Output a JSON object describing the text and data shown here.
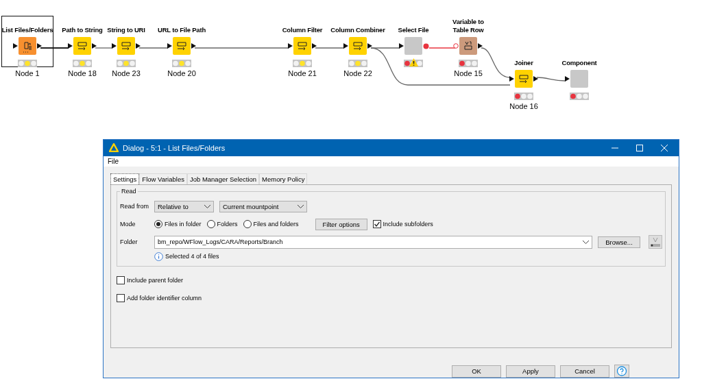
{
  "workflow": {
    "nodes": [
      {
        "label": "List Files/Folders",
        "name": "Node 1",
        "kind": "source",
        "configured": true,
        "selected": true
      },
      {
        "label": "Path to String",
        "name": "Node 18",
        "kind": "manipulator",
        "configured": true,
        "selected": false
      },
      {
        "label": "String to URI",
        "name": "Node 23",
        "kind": "manipulator",
        "configured": true,
        "selected": false
      },
      {
        "label": "URL to File Path",
        "name": "Node 20",
        "kind": "manipulator",
        "configured": true,
        "selected": false
      },
      {
        "label": "Column Filter",
        "name": "Node 21",
        "kind": "manipulator",
        "configured": true,
        "selected": false
      },
      {
        "label": "Column Combiner",
        "name": "Node 22",
        "kind": "manipulator",
        "configured": true,
        "selected": false
      },
      {
        "label": "Select File",
        "kind": "missing",
        "configured": false,
        "warning": true,
        "selected": false
      },
      {
        "label": "Variable to Table Row",
        "name": "Node 15",
        "kind": "variable",
        "configured": false,
        "selected": false
      },
      {
        "label": "Joiner",
        "name": "Node 16",
        "kind": "manipulator",
        "configured": false,
        "selected": false
      },
      {
        "label": "Component",
        "kind": "missing",
        "configured": false,
        "selected": false
      }
    ]
  },
  "dialog": {
    "title": "Dialog - 5:1 - List Files/Folders",
    "menu": [
      "File"
    ],
    "tabs": [
      {
        "label": "Settings",
        "selected": true
      },
      {
        "label": "Flow Variables",
        "selected": false
      },
      {
        "label": "Job Manager Selection",
        "selected": false
      },
      {
        "label": "Memory Policy",
        "selected": false
      }
    ],
    "group": "Read",
    "read_from": {
      "label": "Read from",
      "value": "Relative to",
      "target": "Current mountpoint"
    },
    "mode": {
      "label": "Mode",
      "options": [
        {
          "label": "Files in folder",
          "selected": true
        },
        {
          "label": "Folders",
          "selected": false
        },
        {
          "label": "Files and folders",
          "selected": false
        }
      ],
      "filter_button": "Filter options",
      "subfolders": {
        "label": "Include subfolders",
        "checked": true
      }
    },
    "folder": {
      "label": "Folder",
      "value": "bm_repo/WFlow_Logs/CARA/Reports/Branch",
      "browse": "Browse...",
      "info": "Selected 4 of 4 files"
    },
    "options": [
      {
        "label": "Include parent folder",
        "checked": false
      },
      {
        "label": "Add folder identifier column",
        "checked": false
      }
    ],
    "buttons": [
      "OK",
      "Apply",
      "Cancel"
    ]
  }
}
